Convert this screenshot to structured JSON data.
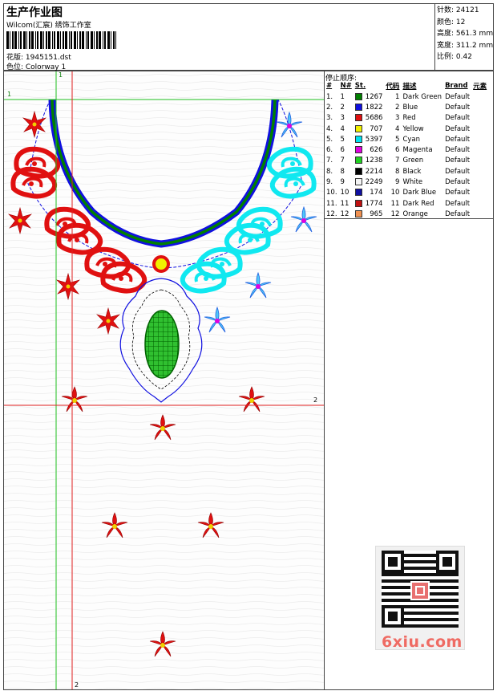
{
  "header": {
    "title": "生产作业图",
    "subtitle": "Wilcom(汇宸) 绣饰工作室",
    "design_label": "花版: 1945151.dst",
    "colorway_label": "色位: Colorway 1"
  },
  "stats": [
    {
      "label": "针数:",
      "value": "24121"
    },
    {
      "label": "颜色:",
      "value": "12"
    },
    {
      "label": "高度:",
      "value": "561.3 mm"
    },
    {
      "label": "宽度:",
      "value": "311.2 mm"
    },
    {
      "label": "比例:",
      "value": "0.42"
    }
  ],
  "stop_sequence": {
    "title": "停止顺序:",
    "headers": [
      "#",
      "N#",
      "St.",
      "代码",
      "描述",
      "Brand",
      "元素"
    ],
    "rows": [
      {
        "n": "1.",
        "nn": "1",
        "color": "#008000",
        "st": "1267",
        "code": "1",
        "desc": "Dark Green",
        "brand": "Default"
      },
      {
        "n": "2.",
        "nn": "2",
        "color": "#1010e0",
        "st": "1822",
        "code": "2",
        "desc": "Blue",
        "brand": "Default"
      },
      {
        "n": "3.",
        "nn": "3",
        "color": "#e01010",
        "st": "5686",
        "code": "3",
        "desc": "Red",
        "brand": "Default"
      },
      {
        "n": "4.",
        "nn": "4",
        "color": "#f0f000",
        "st": "707",
        "code": "4",
        "desc": "Yellow",
        "brand": "Default"
      },
      {
        "n": "5.",
        "nn": "5",
        "color": "#00e0f0",
        "st": "5397",
        "code": "5",
        "desc": "Cyan",
        "brand": "Default"
      },
      {
        "n": "6.",
        "nn": "6",
        "color": "#e000e0",
        "st": "626",
        "code": "6",
        "desc": "Magenta",
        "brand": "Default"
      },
      {
        "n": "7.",
        "nn": "7",
        "color": "#20d020",
        "st": "1238",
        "code": "7",
        "desc": "Green",
        "brand": "Default"
      },
      {
        "n": "8.",
        "nn": "8",
        "color": "#000000",
        "st": "2214",
        "code": "8",
        "desc": "Black",
        "brand": "Default"
      },
      {
        "n": "9.",
        "nn": "9",
        "color": "#f4f4f4",
        "st": "2249",
        "code": "9",
        "desc": "White",
        "brand": "Default"
      },
      {
        "n": "10.",
        "nn": "10",
        "color": "#1010a0",
        "st": "174",
        "code": "10",
        "desc": "Dark Blue",
        "brand": "Default"
      },
      {
        "n": "11.",
        "nn": "11",
        "color": "#c01010",
        "st": "1774",
        "code": "11",
        "desc": "Dark Red",
        "brand": "Default"
      },
      {
        "n": "12.",
        "nn": "12",
        "color": "#f09050",
        "st": "965",
        "code": "12",
        "desc": "Orange",
        "brand": "Default"
      }
    ]
  },
  "guides": {
    "h1": "1",
    "h2": "2",
    "v1": "1",
    "v2": "2"
  },
  "watermark": "6xiu.com",
  "colors": {
    "red": "#e01010",
    "cyan": "#10e8f0",
    "blue": "#1010e0",
    "green": "#008000",
    "guide_red": "#e02020",
    "guide_green": "#20c020"
  }
}
